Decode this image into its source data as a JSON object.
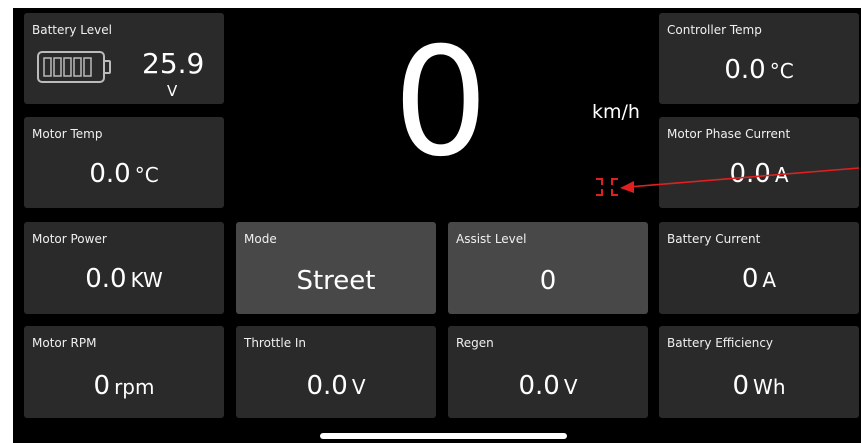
{
  "battery_level": {
    "label": "Battery Level",
    "value": "25.9",
    "unit": "V"
  },
  "speed": {
    "value": "0",
    "unit": "km/h"
  },
  "controller_temp": {
    "label": "Controller Temp",
    "value": "0.0",
    "unit": "°C"
  },
  "motor_temp": {
    "label": "Motor Temp",
    "value": "0.0",
    "unit": "°C"
  },
  "motor_phase_current": {
    "label": "Motor Phase Current",
    "value": "0.0",
    "unit": "A"
  },
  "motor_power": {
    "label": "Motor Power",
    "value": "0.0",
    "unit": "KW"
  },
  "mode": {
    "label": "Mode",
    "value": "Street"
  },
  "assist_level": {
    "label": "Assist Level",
    "value": "0"
  },
  "battery_current": {
    "label": "Battery Current",
    "value": "0",
    "unit": "A"
  },
  "motor_rpm": {
    "label": "Motor RPM",
    "value": "0",
    "unit": "rpm"
  },
  "throttle_in": {
    "label": "Throttle In",
    "value": "0.0",
    "unit": "V"
  },
  "regen": {
    "label": "Regen",
    "value": "0.0",
    "unit": "V"
  },
  "battery_efficiency": {
    "label": "Battery Efficiency",
    "value": "0",
    "unit": "Wh"
  },
  "colors": {
    "background": "#000000",
    "tile": "#2a2a2a",
    "tile_active": "#484848",
    "annotation": "#e02020"
  },
  "icons": [
    "battery-icon",
    "collapse-fullscreen-icon"
  ]
}
